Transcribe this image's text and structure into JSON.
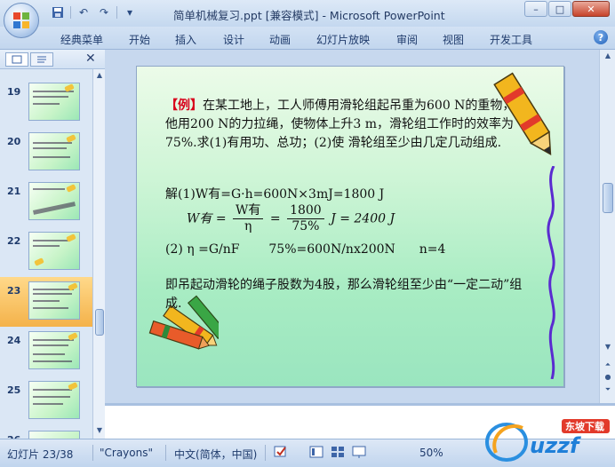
{
  "window": {
    "title": "简单机械复习.ppt [兼容模式] - Microsoft PowerPoint",
    "controls": [
      "–",
      "□",
      "✕"
    ]
  },
  "ribbon": {
    "tabs": [
      "经典菜单",
      "开始",
      "插入",
      "设计",
      "动画",
      "幻灯片放映",
      "审阅",
      "视图",
      "开发工具"
    ]
  },
  "thumbnails": [
    {
      "num": "19"
    },
    {
      "num": "20"
    },
    {
      "num": "21"
    },
    {
      "num": "22"
    },
    {
      "num": "23",
      "active": true
    },
    {
      "num": "24"
    },
    {
      "num": "25"
    },
    {
      "num": "26"
    }
  ],
  "slide": {
    "example_tag": "【例】",
    "problem": "在某工地上，工人师傅用滑轮组起吊重为600 N的重物，他用200 N的力拉绳，使物体上升3 m，滑轮组工作时的效率为75%.求(1)有用功、总功；(2)使 滑轮组至少由几定几动组成.",
    "solution_1": "解(1)W有=G·h=600N×3mJ=1800 J",
    "formula": {
      "lhs": "W有",
      "frac1_num": "W有",
      "frac1_den": "η",
      "frac2_num": "1800",
      "frac2_den": "75%",
      "rhs": "J = 2400 J"
    },
    "solution_2a": "(2) η =G/nF",
    "solution_2b": "75%=600N/nx200N",
    "solution_2c": "n=4",
    "conclusion": "即吊起动滑轮的绳子股数为4股，那么滑轮组至少由“一定二动”组成."
  },
  "statusbar": {
    "slide_info": "幻灯片 23/38",
    "theme": "\"Crayons\"",
    "language": "中文(简体，中国)",
    "zoom": "50%"
  },
  "watermark": {
    "brand": "uzzf",
    "sub": "东坡下载"
  },
  "colors": {
    "accent_red": "#d8001a",
    "slide_green": "#a8ecc3",
    "active_thumb": "#f4b24a"
  }
}
